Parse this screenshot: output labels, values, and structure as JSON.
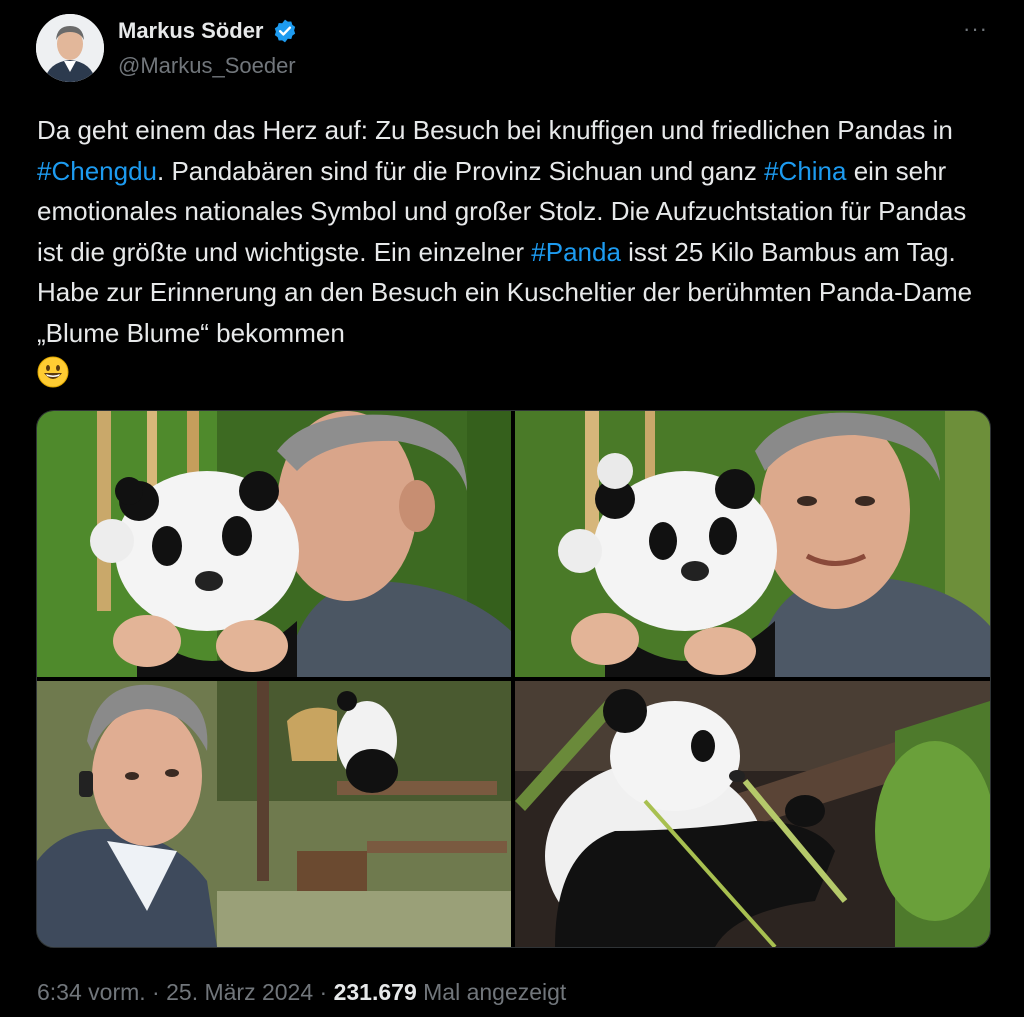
{
  "author": {
    "name": "Markus Söder",
    "handle": "@Markus_Soeder"
  },
  "more_label": "···",
  "tweet": {
    "t1": "Da geht einem das Herz auf: Zu Besuch bei knuffigen und friedlichen Pandas in ",
    "tag1": "#Chengdu",
    "t2": ". Pandabären sind für die Provinz Sichuan und ganz ",
    "tag2": "#China",
    "t3": " ein sehr emotionales nationales Symbol und großer Stolz. Die Aufzuchtstation für Pandas ist die größte und wichtigste. Ein einzelner ",
    "tag3": "#Panda",
    "t4": " isst 25 Kilo Bambus am Tag. Habe zur Erinnerung an den Besuch ein Kuscheltier der berühmten Panda-Dame „Blume Blume“ bekommen"
  },
  "meta": {
    "time": "6:34 vorm.",
    "sep1": " · ",
    "date": "25. März 2024",
    "sep2": " · ",
    "views": "231.679",
    "views_label": " Mal angezeigt"
  },
  "colors": {
    "background": "#000000",
    "text": "#e7e9ea",
    "secondary": "#71767b",
    "link": "#1d9bf0",
    "verified": "#1d9bf0"
  },
  "icons": [
    "verified-badge-icon",
    "more-options-icon",
    "grinning-face-emoji"
  ]
}
